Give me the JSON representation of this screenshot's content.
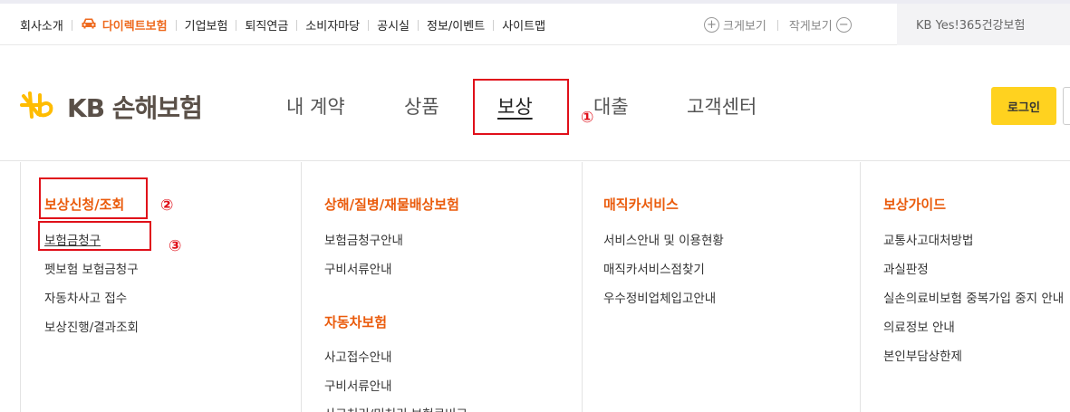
{
  "utility_nav": {
    "items": [
      "회사소개",
      "다이렉트보험",
      "기업보험",
      "퇴직연금",
      "소비자마당",
      "공시실",
      "정보/이벤트",
      "사이트맵"
    ],
    "highlight_color": "#ee6a1f"
  },
  "zoom": {
    "zoom_in_label": "크게보기",
    "zoom_out_label": "작게보기",
    "plus_symbol": "+",
    "minus_symbol": "−"
  },
  "promo_text": "KB Yes!365건강보험",
  "logo": {
    "text": "KB 손해보험",
    "brand_color": "#ffbc00"
  },
  "main_nav": {
    "items": [
      "내 계약",
      "상품",
      "보상",
      "대출",
      "고객센터"
    ],
    "active": "보상"
  },
  "login_label": "로그인",
  "mega_menu": {
    "col1": {
      "title": "보상신청/조회",
      "links": [
        "보험금청구",
        "펫보험 보험금청구",
        "자동차사고 접수",
        "보상진행/결과조회"
      ]
    },
    "col2": {
      "title": "상해/질병/재물배상보험",
      "links": [
        "보험금청구안내",
        "구비서류안내"
      ],
      "title2": "자동차보험",
      "links2": [
        "사고접수안내",
        "구비서류안내",
        "사고처리/미처리 보험료비교"
      ]
    },
    "col3": {
      "title": "매직카서비스",
      "links": [
        "서비스안내 및 이용현황",
        "매직카서비스점찾기",
        "우수정비업체입고안내"
      ]
    },
    "col4": {
      "title": "보상가이드",
      "links": [
        "교통사고대처방법",
        "과실판정",
        "실손의료비보험 중복가입 중지 안내",
        "의료정보 안내",
        "본인부담상한제"
      ]
    }
  },
  "annotations": {
    "n1": "①",
    "n2": "②",
    "n3": "③",
    "color": "#e0101a"
  }
}
